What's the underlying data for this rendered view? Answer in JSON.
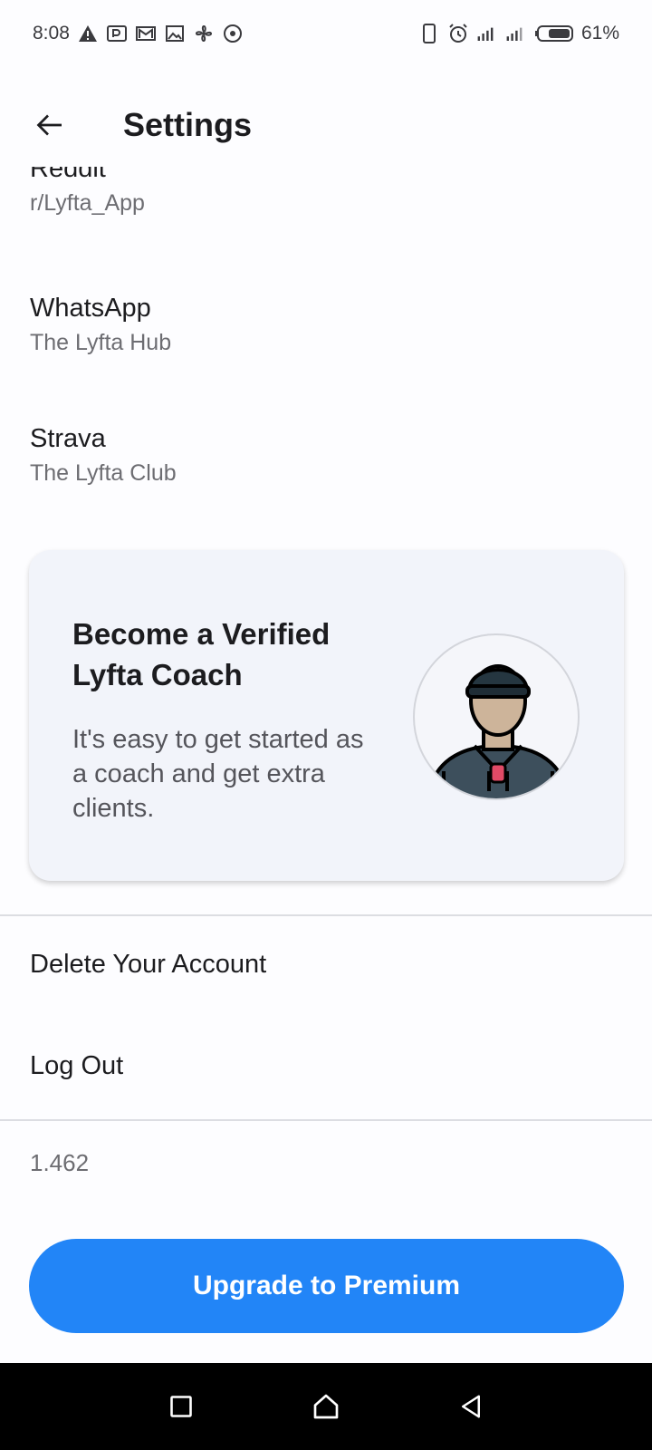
{
  "status_bar": {
    "time": "8:08",
    "battery": "61%",
    "left_icons": [
      "warning-icon",
      "parking-icon",
      "mail-icon",
      "image-icon",
      "fan-icon",
      "record-icon"
    ],
    "right_icons": [
      "phone-icon",
      "alarm-icon",
      "signal-hd-icon",
      "signal-icon",
      "battery-icon"
    ]
  },
  "header": {
    "title": "Settings"
  },
  "social_links": [
    {
      "title": "Reddit",
      "subtitle": "r/Lyfta_App"
    },
    {
      "title": "WhatsApp",
      "subtitle": "The Lyfta Hub"
    },
    {
      "title": "Strava",
      "subtitle": "The Lyfta Club"
    }
  ],
  "coach_card": {
    "title": "Become a Verified Lyfta Coach",
    "body": "It's easy to get started as a coach and get extra clients."
  },
  "account": {
    "delete_label": "Delete Your Account",
    "logout_label": "Log Out"
  },
  "version": "1.462",
  "upgrade_label": "Upgrade to Premium",
  "colors": {
    "accent": "#2285f7",
    "card_bg": "#f2f4fa",
    "nav_bg": "#000000"
  }
}
